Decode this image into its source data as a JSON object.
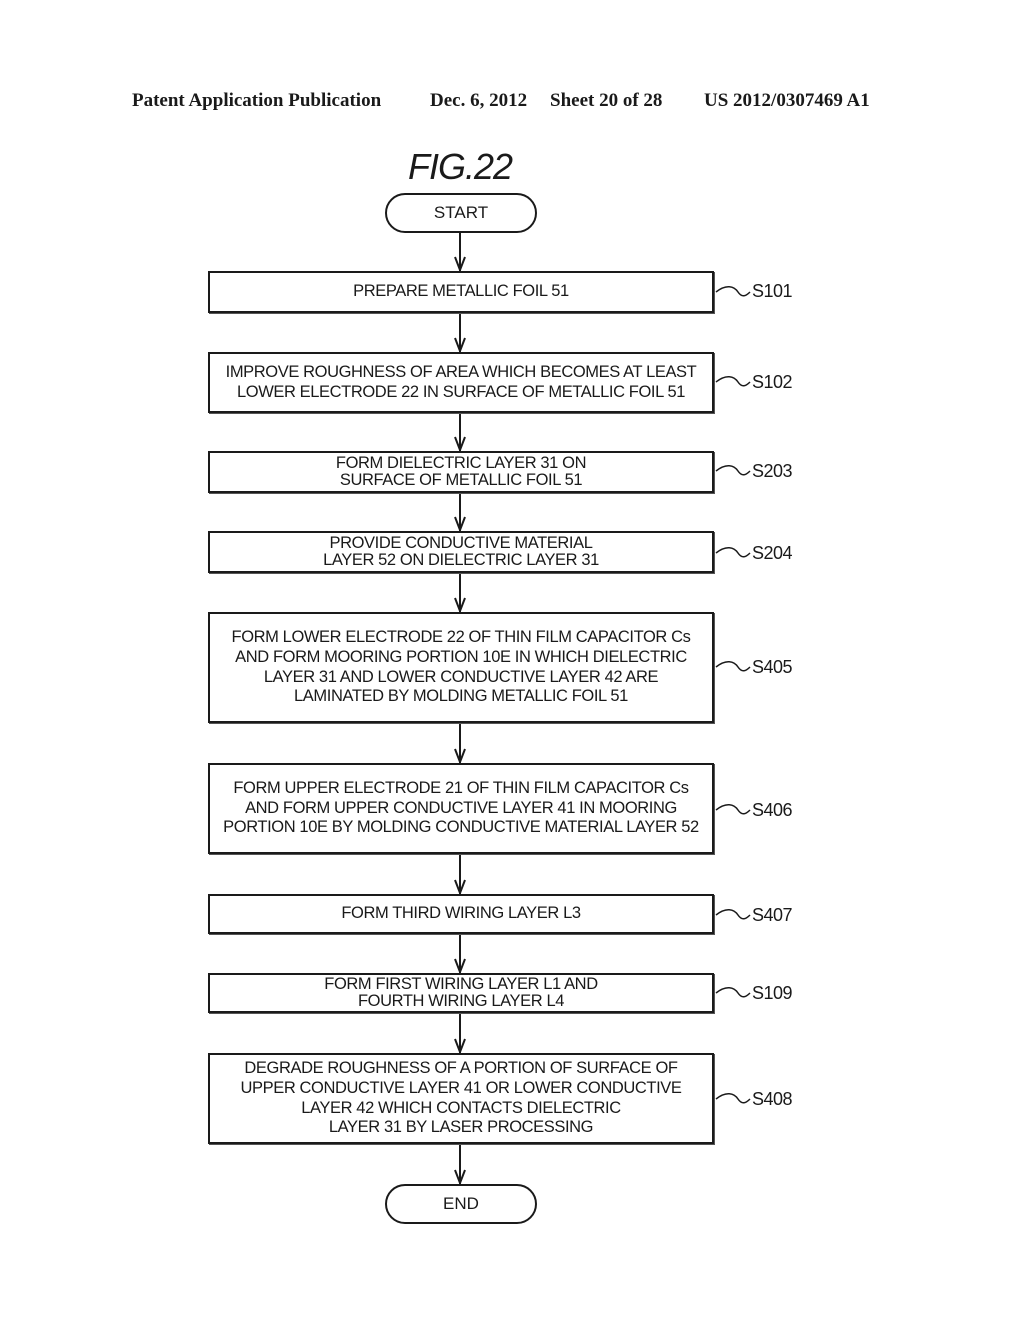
{
  "header": {
    "publication": "Patent Application Publication",
    "date": "Dec. 6, 2012",
    "sheet": "Sheet 20 of 28",
    "number": "US 2012/0307469 A1"
  },
  "figure": {
    "title": "FIG.22",
    "start": "START",
    "end": "END",
    "steps": [
      {
        "id": "S101",
        "text": "PREPARE METALLIC FOIL 51"
      },
      {
        "id": "S102",
        "text": "IMPROVE ROUGHNESS OF AREA WHICH BECOMES AT LEAST\nLOWER ELECTRODE 22 IN SURFACE OF METALLIC FOIL 51"
      },
      {
        "id": "S203",
        "text": "FORM DIELECTRIC LAYER 31 ON\nSURFACE OF METALLIC FOIL 51"
      },
      {
        "id": "S204",
        "text": "PROVIDE CONDUCTIVE MATERIAL\nLAYER 52 ON DIELECTRIC LAYER 31"
      },
      {
        "id": "S405",
        "text": "FORM LOWER ELECTRODE 22 OF THIN FILM CAPACITOR Cs\nAND FORM MOORING PORTION 10E IN WHICH DIELECTRIC\nLAYER 31 AND LOWER CONDUCTIVE LAYER 42 ARE\nLAMINATED BY MOLDING METALLIC FOIL 51"
      },
      {
        "id": "S406",
        "text": "FORM UPPER ELECTRODE 21 OF THIN FILM CAPACITOR Cs\nAND FORM UPPER CONDUCTIVE LAYER 41 IN MOORING\nPORTION 10E BY MOLDING CONDUCTIVE MATERIAL LAYER 52"
      },
      {
        "id": "S407",
        "text": "FORM THIRD WIRING LAYER L3"
      },
      {
        "id": "S109",
        "text": "FORM FIRST WIRING LAYER L1 AND\nFOURTH WIRING LAYER L4"
      },
      {
        "id": "S408",
        "text": "DEGRADE ROUGHNESS OF A PORTION OF SURFACE OF\nUPPER CONDUCTIVE LAYER 41 OR LOWER CONDUCTIVE\nLAYER 42 WHICH CONTACTS DIELECTRIC\nLAYER 31 BY LASER PROCESSING"
      }
    ]
  }
}
